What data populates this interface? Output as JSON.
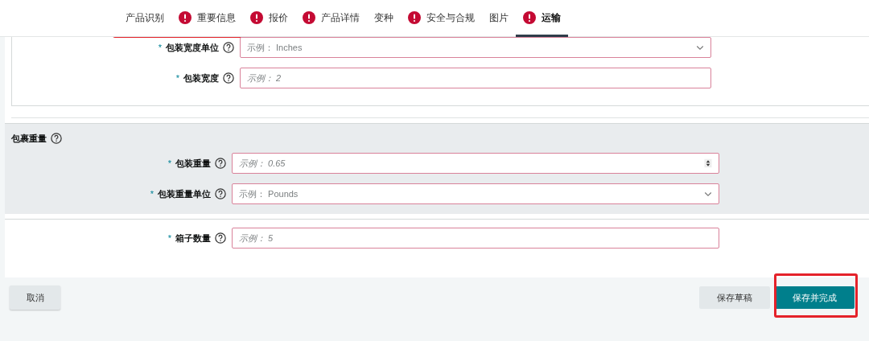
{
  "tabs": [
    {
      "label": "产品识别",
      "error": false,
      "selected": false
    },
    {
      "label": "重要信息",
      "error": true,
      "selected": false
    },
    {
      "label": "报价",
      "error": true,
      "selected": false
    },
    {
      "label": "产品详情",
      "error": true,
      "selected": false
    },
    {
      "label": "变种",
      "error": false,
      "selected": false
    },
    {
      "label": "安全与合规",
      "error": true,
      "selected": false
    },
    {
      "label": "图片",
      "error": false,
      "selected": false
    },
    {
      "label": "运输",
      "error": true,
      "selected": true
    }
  ],
  "sections": [
    {
      "kind": "card",
      "fields": [
        {
          "label": "包装宽度单位",
          "required_mark": "*",
          "kind": "select",
          "placeholder": "示例： Inches"
        },
        {
          "label": "包装宽度",
          "required_mark": "*",
          "kind": "text",
          "placeholder": "示例： 2"
        }
      ]
    },
    {
      "kind": "group",
      "title": "包裹重量",
      "fields": [
        {
          "label": "包装重量",
          "required_mark": "*",
          "kind": "number",
          "placeholder": "示例： 0.65"
        },
        {
          "label": "包装重量单位",
          "required_mark": "*",
          "kind": "select",
          "placeholder": "示例： Pounds"
        }
      ]
    },
    {
      "kind": "plain",
      "fields": [
        {
          "label": "箱子数量",
          "required_mark": "*",
          "kind": "text",
          "placeholder": "示例： 5"
        }
      ]
    }
  ],
  "footer": {
    "cancel": "取消",
    "buttons": [
      {
        "label": "保存草稿",
        "kind": "secondary"
      },
      {
        "label": "保存并完成",
        "kind": "primary"
      }
    ]
  }
}
